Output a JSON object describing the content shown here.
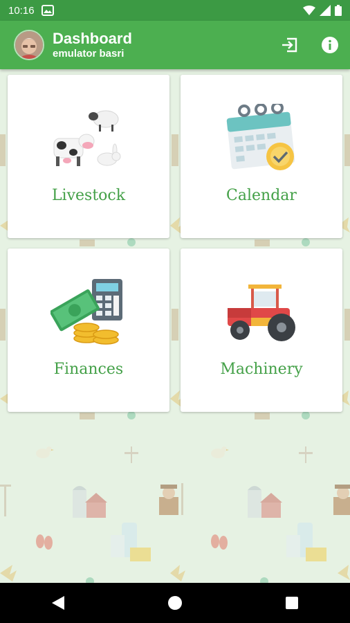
{
  "status_bar": {
    "time": "10:16"
  },
  "app_bar": {
    "title": "Dashboard",
    "subtitle": "emulator basri",
    "actions": [
      {
        "icon": "logout-icon"
      },
      {
        "icon": "info-icon"
      }
    ]
  },
  "cards": [
    {
      "label": "Livestock",
      "icon": "livestock-icon"
    },
    {
      "label": "Calendar",
      "icon": "calendar-icon"
    },
    {
      "label": "Finances",
      "icon": "finances-icon"
    },
    {
      "label": "Machinery",
      "icon": "machinery-icon"
    }
  ],
  "colors": {
    "status_bar": "#3c9a44",
    "app_bar": "#4caf50",
    "background": "#e6f2e3",
    "label": "#43a047"
  }
}
